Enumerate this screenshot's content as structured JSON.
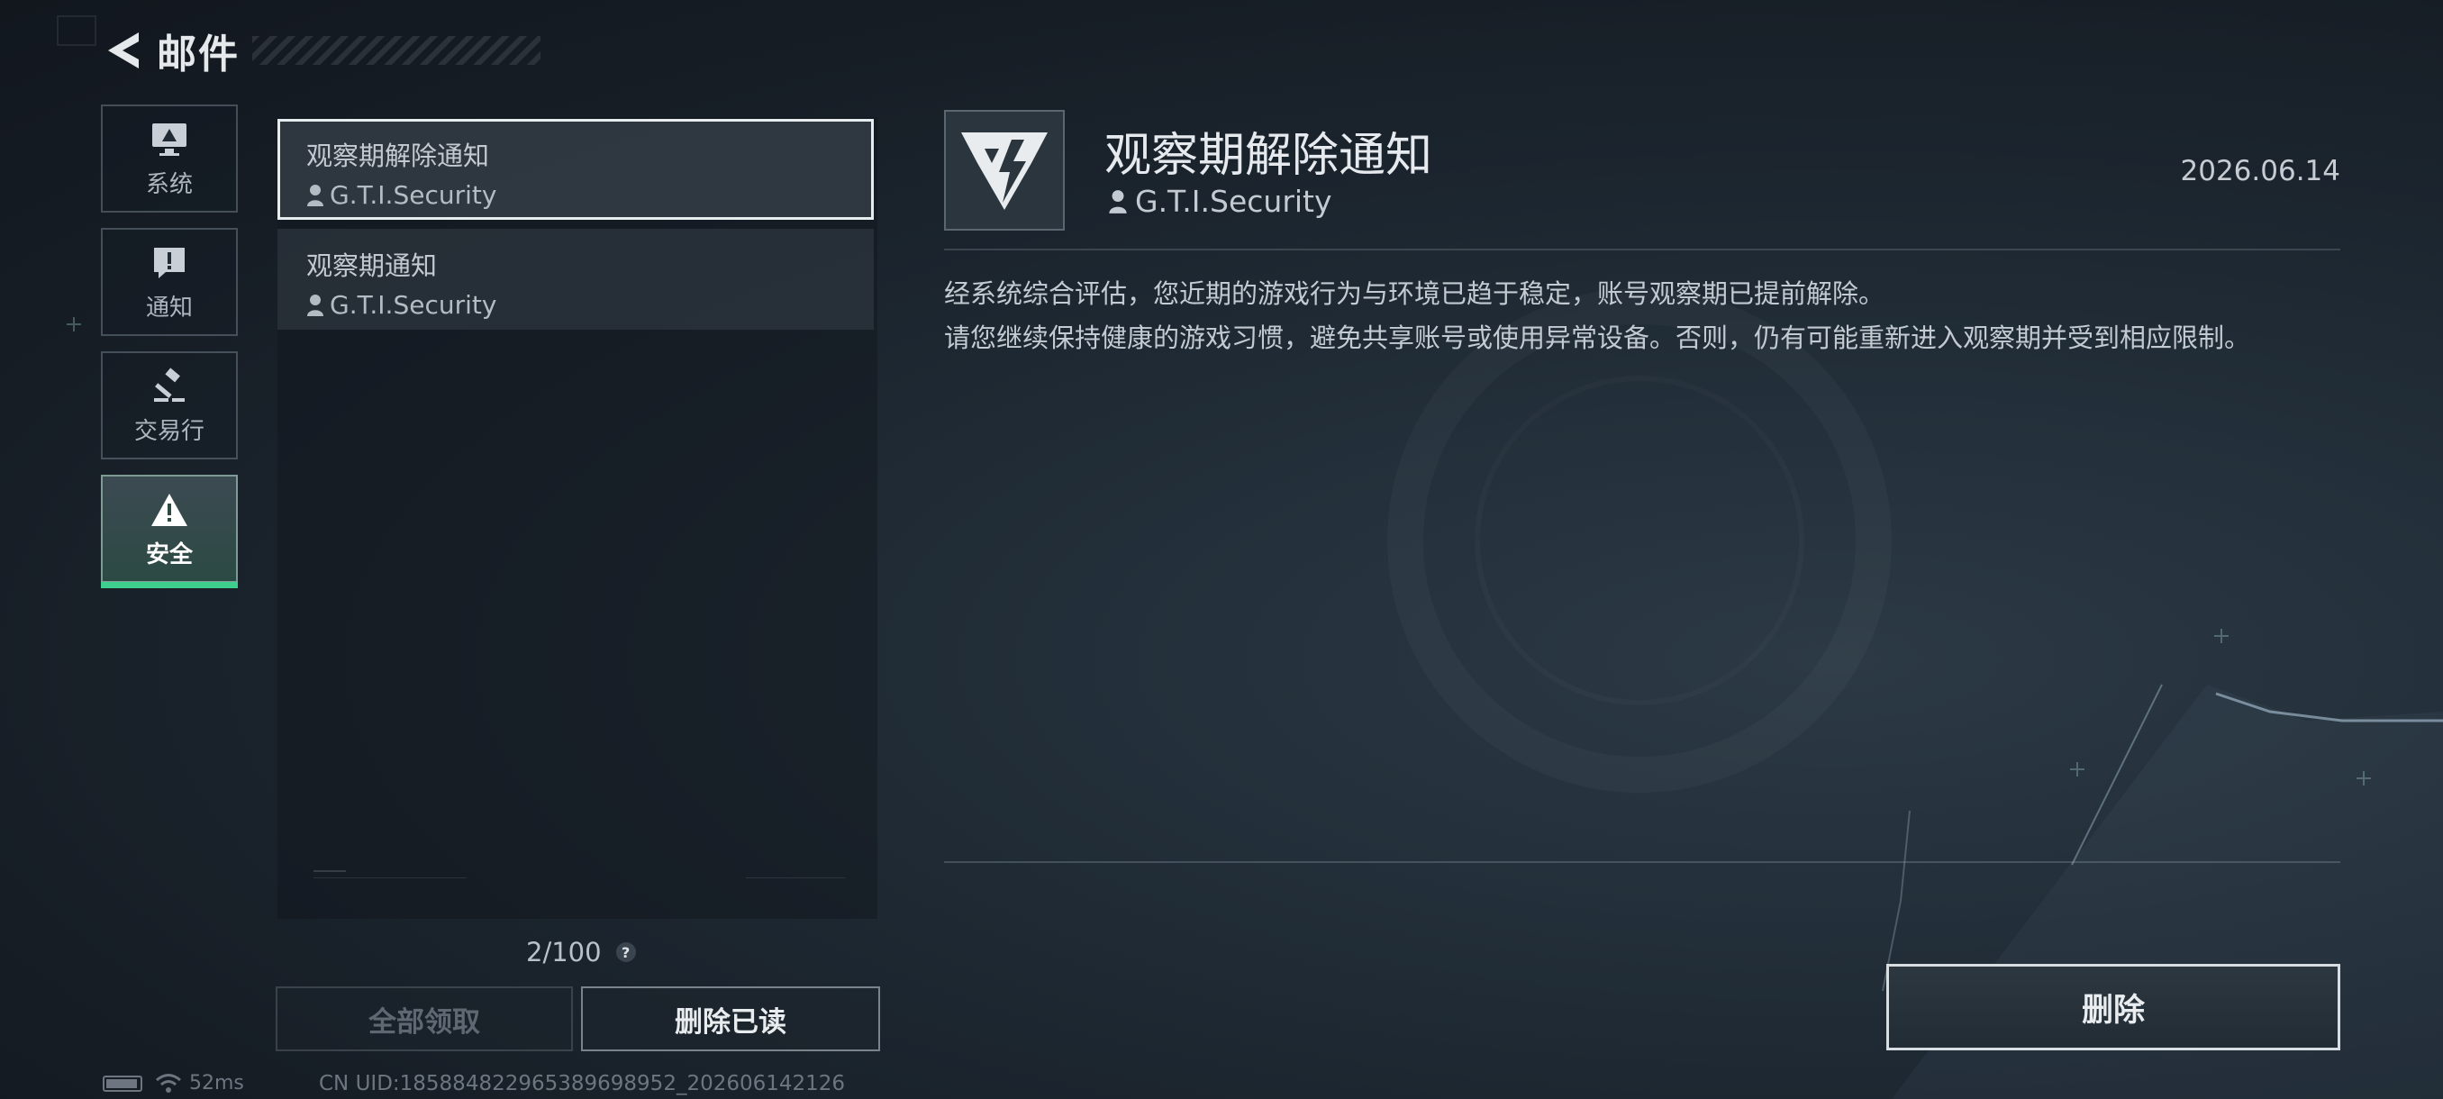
{
  "header": {
    "title": "邮件",
    "back_icon": "back-arrow-icon"
  },
  "categories": [
    {
      "label": "系统",
      "icon": "monitor-icon",
      "active": false
    },
    {
      "label": "通知",
      "icon": "exclamation-bubble-icon",
      "active": false
    },
    {
      "label": "交易行",
      "icon": "gavel-icon",
      "active": false
    },
    {
      "label": "安全",
      "icon": "warning-triangle-icon",
      "active": true
    }
  ],
  "mail_list": {
    "items": [
      {
        "subject": "观察期解除通知",
        "sender": "G.T.I.Security",
        "selected": true
      },
      {
        "subject": "观察期通知",
        "sender": "G.T.I.Security",
        "selected": false
      }
    ],
    "count": "2/100",
    "help_label": "?"
  },
  "actions": {
    "claim_all": "全部领取",
    "delete_read": "删除已读",
    "delete": "删除"
  },
  "detail": {
    "title": "观察期解除通知",
    "sender": "G.T.I.Security",
    "date": "2026.06.14",
    "logo_icon": "gti-logo-icon",
    "body": [
      "经系统综合评估，您近期的游戏行为与环境已趋于稳定，账号观察期已提前解除。",
      "请您继续保持健康的游戏习惯，避免共享账号或使用异常设备。否则，仍有可能重新进入观察期并受到相应限制。"
    ]
  },
  "status": {
    "ping": "52ms",
    "uid": "CN UID:185884822965389698952_202606142126"
  },
  "colors": {
    "accent_green": "#3ecf8e",
    "background": "#1a222b"
  }
}
